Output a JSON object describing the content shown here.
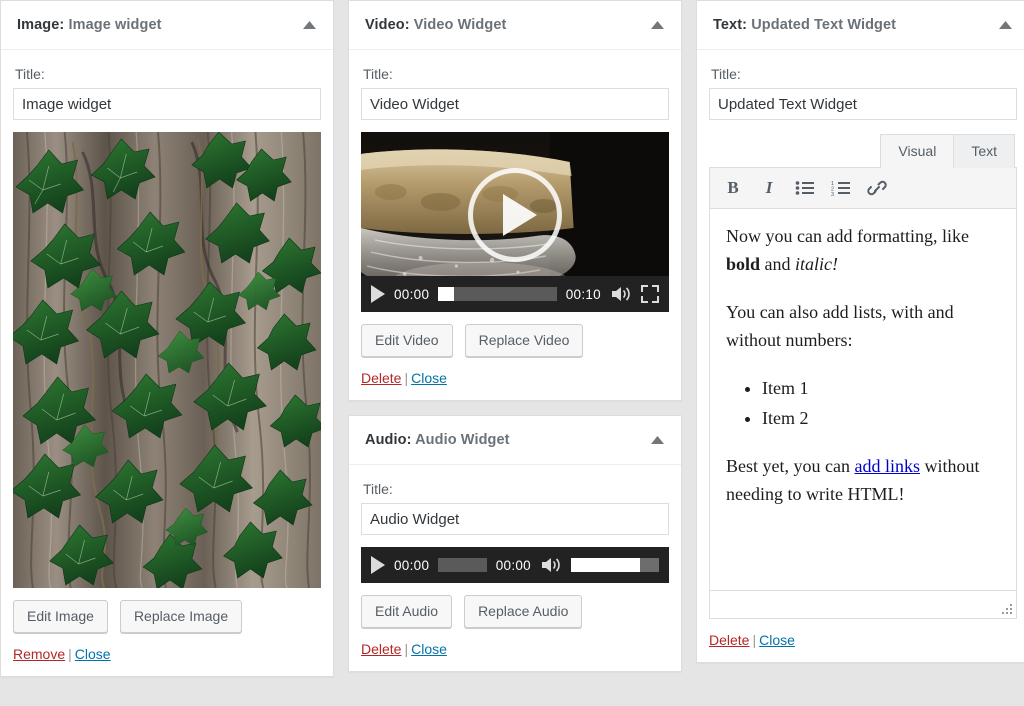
{
  "widgets": {
    "image": {
      "type_label": "Image:",
      "name": "Image widget",
      "field_label": "Title:",
      "title_value": "Image widget",
      "edit_button": "Edit Image",
      "replace_button": "Replace Image",
      "delete_link": "Remove",
      "close_link": "Close",
      "separator": "|",
      "media_alt": "Green ivy leaves climbing textured tree bark"
    },
    "video": {
      "type_label": "Video:",
      "name": "Video Widget",
      "field_label": "Title:",
      "title_value": "Video Widget",
      "edit_button": "Edit Video",
      "replace_button": "Replace Video",
      "delete_link": "Delete",
      "close_link": "Close",
      "separator": "|",
      "player": {
        "current_time": "00:00",
        "duration": "00:10",
        "progress_percent": 0
      },
      "media_alt": "Water flowing over a stone ledge"
    },
    "audio": {
      "type_label": "Audio:",
      "name": "Audio Widget",
      "field_label": "Title:",
      "title_value": "Audio Widget",
      "edit_button": "Edit Audio",
      "replace_button": "Replace Audio",
      "delete_link": "Delete",
      "close_link": "Close",
      "separator": "|",
      "player": {
        "current_time": "00:00",
        "duration": "00:00",
        "progress_percent": 0,
        "volume_percent": 78
      }
    },
    "text": {
      "type_label": "Text:",
      "name": "Updated Text Widget",
      "field_label": "Title:",
      "title_value": "Updated Text Widget",
      "delete_link": "Delete",
      "close_link": "Close",
      "separator": "|",
      "tabs": {
        "visual": "Visual",
        "text": "Text",
        "active": "Visual"
      },
      "toolbar": {
        "bold": "B",
        "italic": "I",
        "bullet_list": "bullet-list-icon",
        "numbered_list": "numbered-list-icon",
        "link": "link-icon"
      },
      "content": {
        "para1_before_bold": "Now you can add formatting, like ",
        "para1_bold": "bold",
        "para1_between": " and ",
        "para1_italic": "italic!",
        "para2": "You can also add lists, with and without numbers:",
        "list_items": [
          "Item 1",
          "Item 2"
        ],
        "para3_before_link": "Best yet, you can ",
        "para3_link": "add links",
        "para3_after_link": " without needing to write HTML!"
      }
    }
  },
  "icons": {
    "collapse": "triangle-up-icon",
    "play": "play-icon",
    "volume": "volume-icon",
    "fullscreen": "fullscreen-icon",
    "resize": "resize-handle-icon"
  },
  "colors": {
    "link": "#0073aa",
    "danger": "#b52727",
    "editor_link": "#0000cc",
    "panel_bg": "#ffffff",
    "page_bg": "#e5e5e5",
    "player_bg": "#222222"
  }
}
